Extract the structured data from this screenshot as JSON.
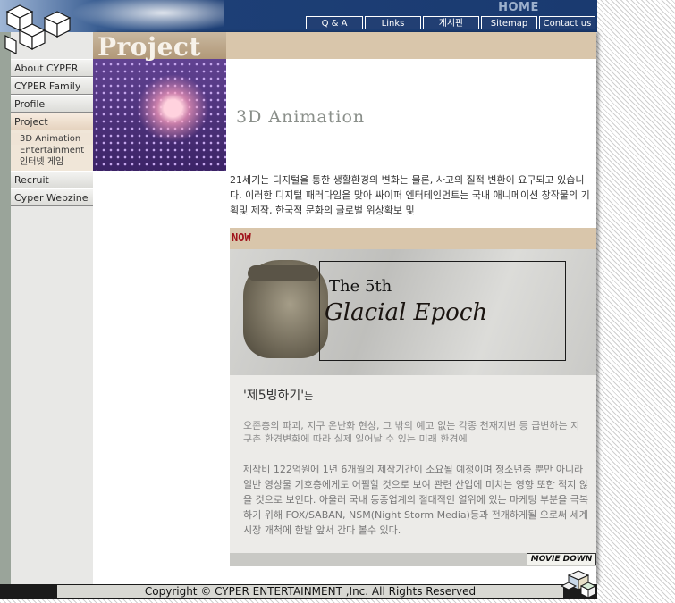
{
  "header": {
    "home_label": "HOME",
    "nav": [
      {
        "label": "Q & A"
      },
      {
        "label": "Links"
      },
      {
        "label": "게시판"
      },
      {
        "label": "Sitemap"
      },
      {
        "label": "Contact us"
      }
    ]
  },
  "sidebar": {
    "items": [
      {
        "label": "About CYPER"
      },
      {
        "label": "CYPER Family"
      },
      {
        "label": "Profile"
      },
      {
        "label": "Project"
      }
    ],
    "sub_items": [
      {
        "label": "3D Animation"
      },
      {
        "label": "Entertainment"
      },
      {
        "label": "인터넷 게임"
      }
    ],
    "items_after": [
      {
        "label": "Recruit"
      },
      {
        "label": "Cyper Webzine"
      }
    ]
  },
  "banner": {
    "title": "Project"
  },
  "main": {
    "section_heading": "3D Animation",
    "intro": "21세기는 디지털을 통한 생활환경의 변화는 물론, 사고의 질적 변환이 요구되고 있습니다. 이러한 디지털 패러다임을 맞아 싸이퍼 엔터테인먼트는 국내 애니메이션 창작물의 기획및 제작, 한국적 문화의 글로벌 위상확보 및",
    "now_label": "NOW",
    "feature": {
      "film_line1": "The 5th",
      "film_line2": "Glacial Epoch",
      "heading": "'제5빙하기'",
      "heading_suffix": "는",
      "paragraph1": "오존층의 파괴, 지구 온난화 현상, 그 밖의 예고 없는 각종 천재지변 등 급변하는 지구촌 환경변화에 따라 실제 일어날 수 있는 미래 환경에",
      "paragraph2": "제작비 122억원에 1년 6개월의 제작기간이 소요될 예정이며 청소년층 뿐만 아니라 일반 영상물 기호층에게도 어필할 것으로 보여 관련 산업에 미치는 영향 또한 적지 않을 것으로 보인다. 아울러 국내 동종업계의 절대적인 열위에 있는 마케팅 부분을 극복하기 위해 FOX/SABAN, NSM(Night Storm Media)등과 전개하게될 으로써 세계시장 개척에 한발 앞서 간다 볼수 있다.",
      "download_label": "MOVIE DOWN"
    }
  },
  "footer": {
    "copyright": "Copyright © CYPER ENTERTAINMENT ,Inc. All Rights Reserved"
  },
  "colors": {
    "header_blue": "#1d3f76",
    "accent_tan": "#d9c6ab",
    "now_red": "#a0121a"
  }
}
